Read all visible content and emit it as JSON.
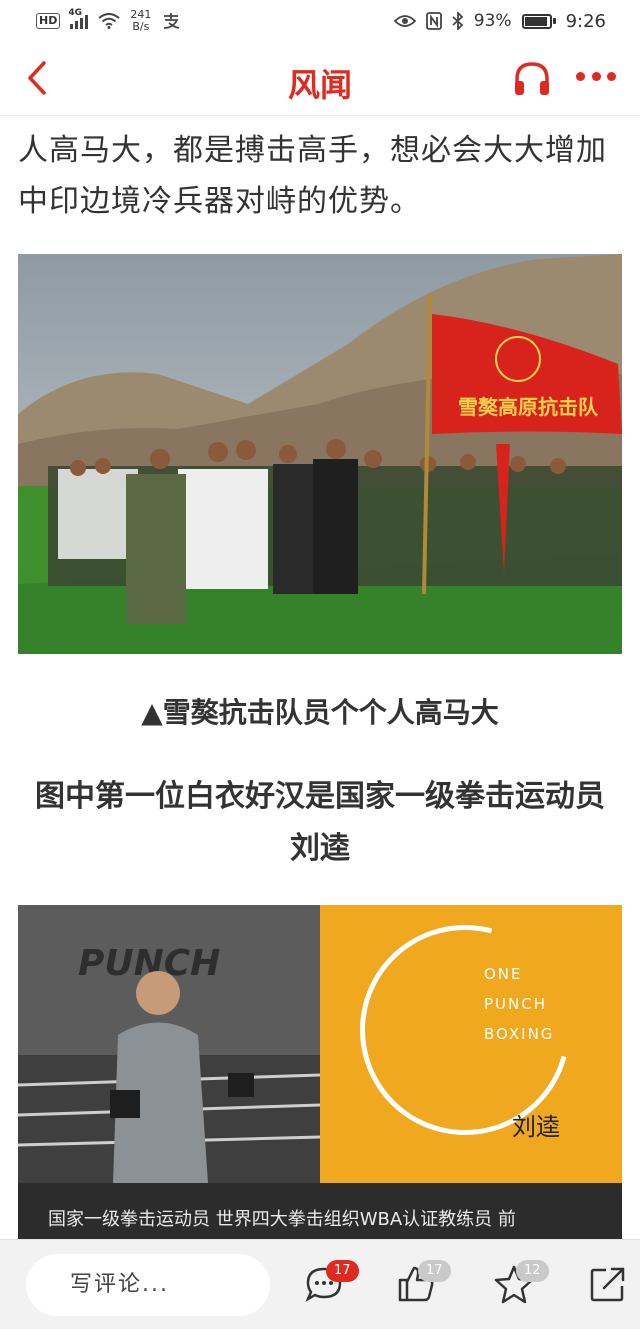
{
  "status_bar": {
    "hd": "HD",
    "network": "4G",
    "speed_value": "241",
    "speed_unit": "B/s",
    "battery": "93%",
    "battery_level": 0.93,
    "time": "9:26"
  },
  "header": {
    "title": "风闻"
  },
  "article": {
    "paragraph": "人高马大，都是搏击高手，想必会大大增加中印边境冷兵器对峙的优势。",
    "photo1_caption": "▲雪獒抗击队员个个人高马大",
    "photo1_flag_text": "雪獒高原抗击队",
    "subheading": "图中第一位白衣好汉是国家一级拳击运动员刘逵",
    "photo2": {
      "brand_lines": [
        "ONE",
        "PUNCH",
        "BOXING"
      ],
      "person_name": "刘逵",
      "wall_text": "PUNCH",
      "strip_text": "国家一级拳击运动员 世界四大拳击组织WBA认证教练员 前",
      "strip_text2": "……"
    }
  },
  "bottom_bar": {
    "comment_placeholder": "写评论...",
    "comments_count": "17",
    "likes_count": "17",
    "favorites_count": "12"
  },
  "colors": {
    "accent": "#e02a20",
    "flag": "#d8231d",
    "grass": "#3f8f2e",
    "panel_yellow": "#f0a81f"
  }
}
